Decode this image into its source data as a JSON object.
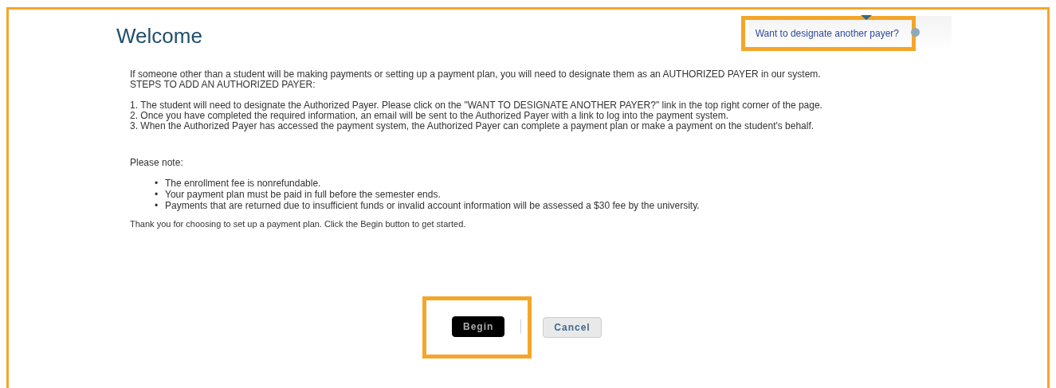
{
  "page": {
    "title": "Welcome",
    "designate_link": "Want to designate another payer?"
  },
  "intro": [
    "If someone other than a student will be making payments or setting up a payment plan, you will need to designate them as an AUTHORIZED PAYER in our system.",
    "STEPS TO ADD AN AUTHORIZED PAYER:"
  ],
  "steps": [
    "1. The student will need to designate the Authorized Payer. Please click on the \"WANT TO DESIGNATE ANOTHER PAYER?\" link in the top right corner of the page.",
    "2. Once you have completed the required information, an email will be sent to the Authorized Payer with a link to log into the payment system.",
    "3. When the Authorized Payer has accessed the payment system, the Authorized Payer can complete a payment plan or make a payment on the student's behalf."
  ],
  "note_heading": "Please note:",
  "notes": [
    {
      "bullet": "•",
      "text": "The enrollment fee is nonrefundable."
    },
    {
      "bullet": "•",
      "text": "Your payment plan must be paid in full before the semester ends."
    },
    {
      "bullet": "•",
      "text": "Payments that are returned due to insufficient funds or invalid account information will be assessed a $30 fee by the university."
    }
  ],
  "closing": "Thank you for choosing to set up a payment plan. Click the Begin button to get started.",
  "buttons": [
    {
      "label": "Begin",
      "kind": "primary"
    },
    {
      "label": "Cancel",
      "kind": "secondary"
    }
  ]
}
